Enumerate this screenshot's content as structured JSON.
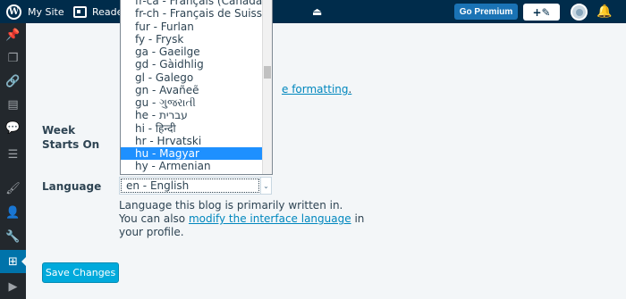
{
  "masterbar": {
    "site_label": "My Site",
    "reader_label": "Reader",
    "go_premium_label": "Go Premium",
    "write_icon": "+✎"
  },
  "settings": {
    "link_fragment": "e formatting",
    "link_trailing": ".",
    "week_starts_label": "Week Starts On",
    "language_label": "Language",
    "language_value": "en - English",
    "desc_line1": "Language this blog is primarily written in.",
    "desc_prefix": "You can also",
    "desc_link": "modify the interface language",
    "desc_suffix": "in your profile.",
    "save_label": "Save Changes"
  },
  "dropdown": {
    "items": [
      "fr-ca - Français (Canada)",
      "fr-ch - Français de Suisse",
      "fur - Furlan",
      "fy - Frysk",
      "ga - Gaeilge",
      "gd - Gàidhlig",
      "gl - Galego",
      "gn - Avañeẽ",
      "gu - ગુજરાતી",
      "he - עברית",
      "hi - हिन्दी",
      "hr - Hrvatski",
      "hu - Magyar",
      "hy - Armenian"
    ],
    "selected_index": 12
  },
  "colors": {
    "masterbar": "#002c4b",
    "sidebar": "#23282d",
    "accent": "#0073aa",
    "button": "#00aadc",
    "selection": "#1e90ff"
  }
}
